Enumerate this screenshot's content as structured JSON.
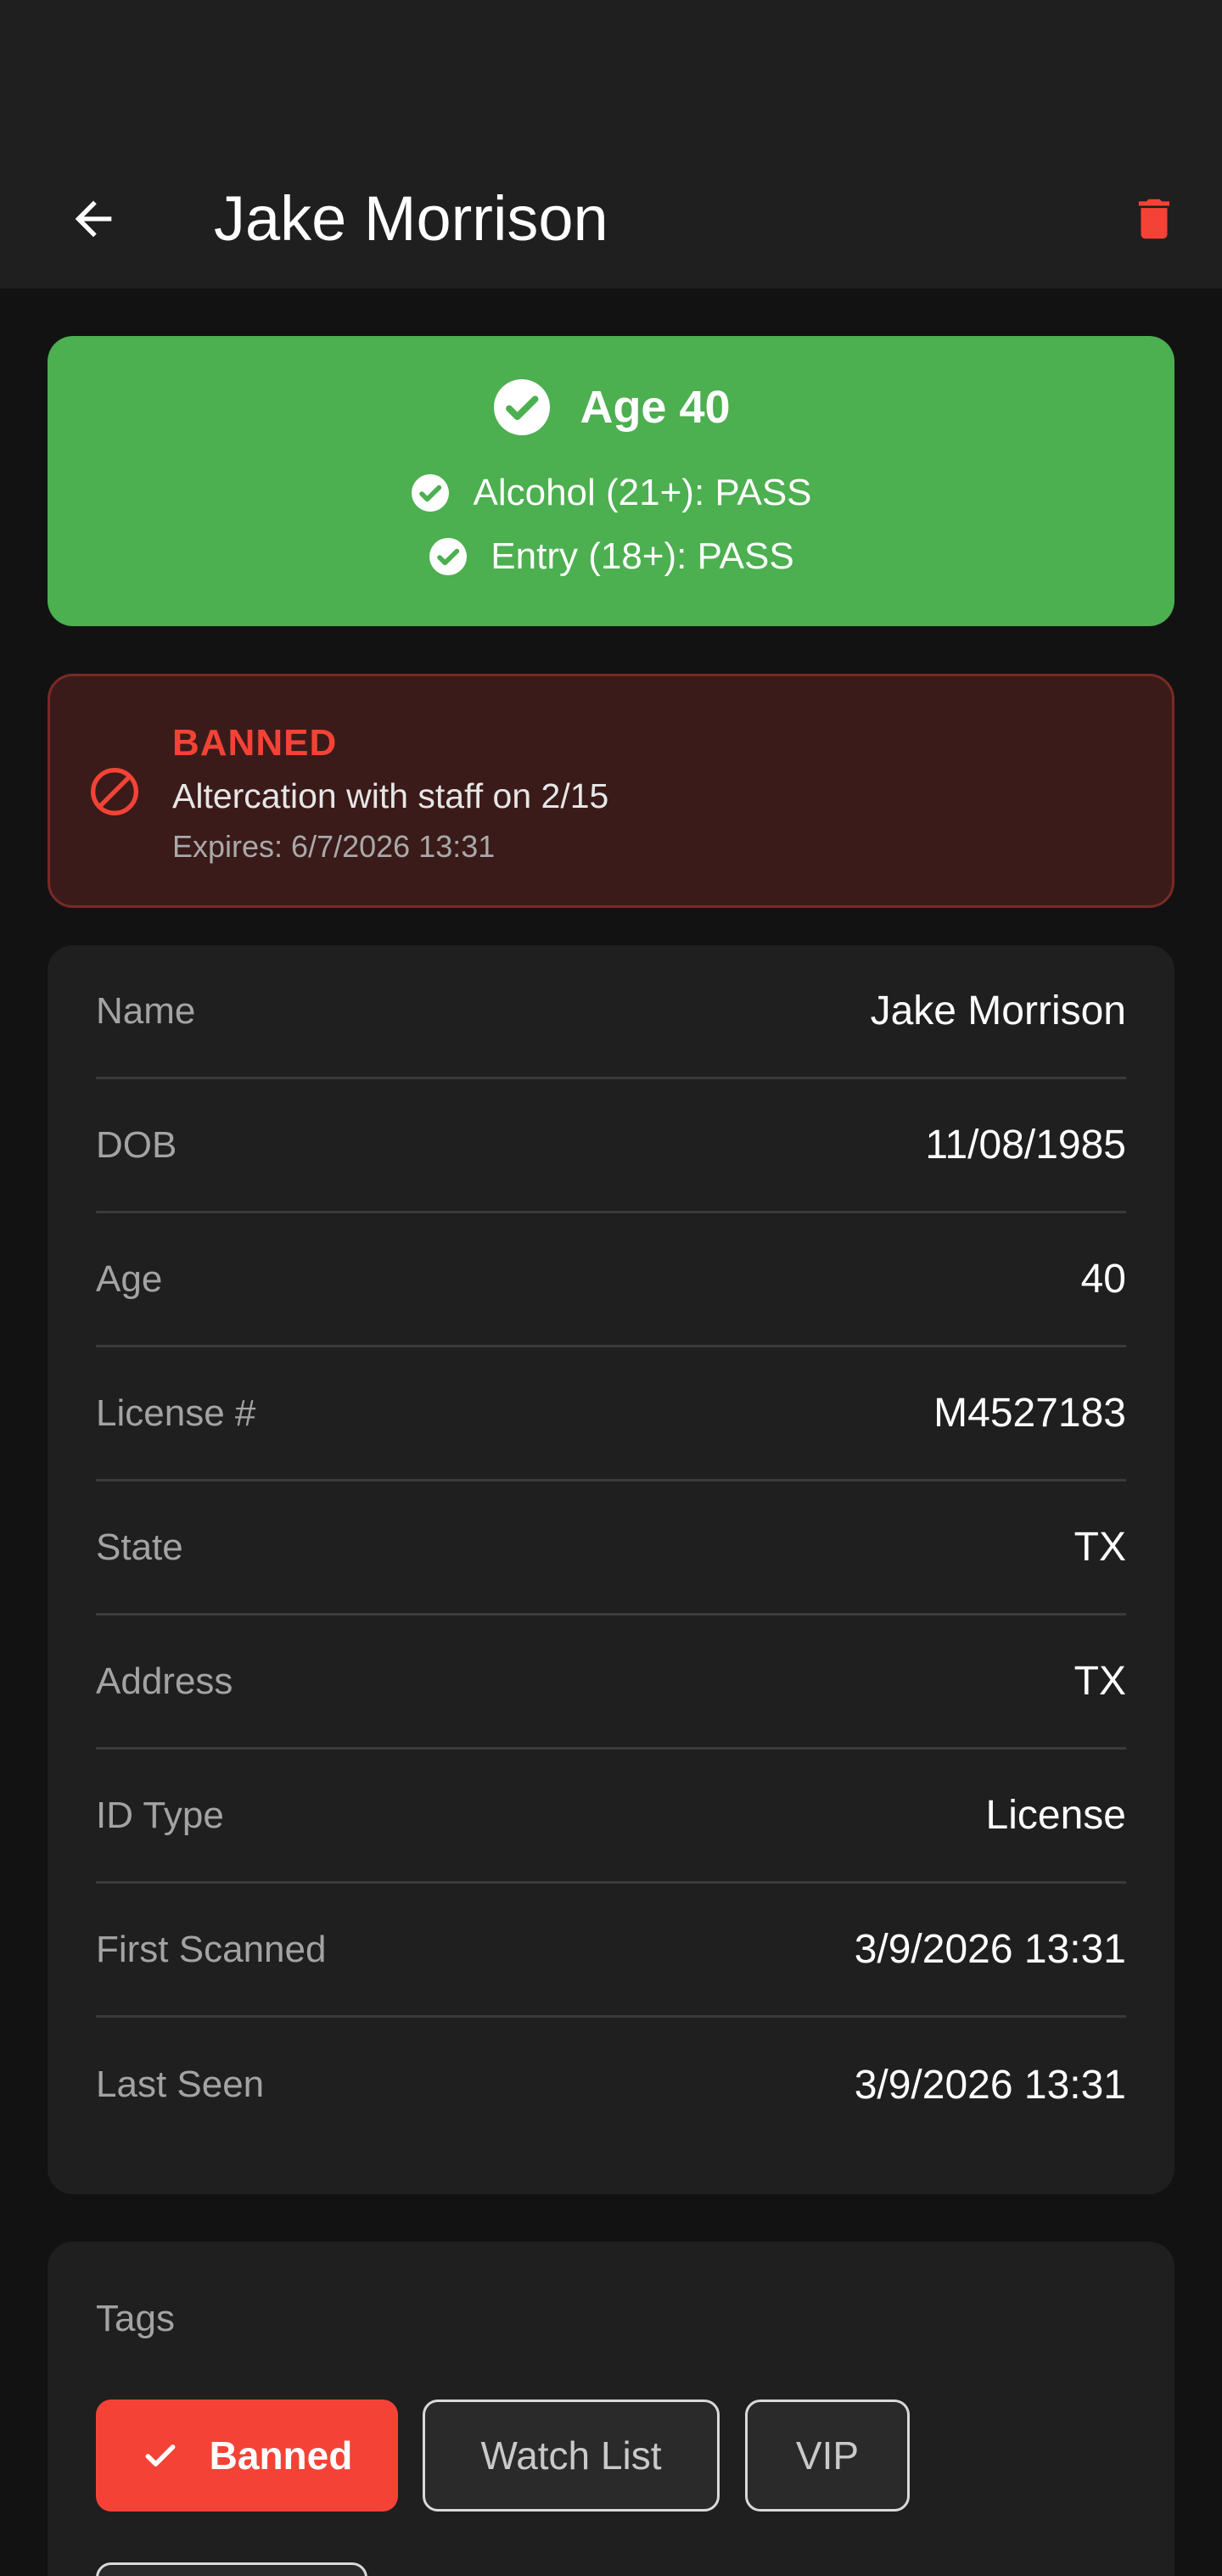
{
  "header": {
    "title": "Jake Morrison"
  },
  "icons": {
    "back": "back-arrow-icon",
    "delete": "trash-icon"
  },
  "colors": {
    "pass": "#4caf50",
    "danger": "#f44336",
    "surface": "#1f1f1f",
    "background": "#121212"
  },
  "age_check": {
    "headline": "Age 40",
    "checks": [
      "Alcohol (21+): PASS",
      "Entry (18+): PASS"
    ]
  },
  "ban": {
    "title": "BANNED",
    "reason": "Altercation with staff on 2/15",
    "expires": "Expires: 6/7/2026 13:31"
  },
  "details": [
    {
      "label": "Name",
      "value": "Jake Morrison"
    },
    {
      "label": "DOB",
      "value": "11/08/1985"
    },
    {
      "label": "Age",
      "value": "40"
    },
    {
      "label": "License #",
      "value": "M4527183"
    },
    {
      "label": "State",
      "value": "TX"
    },
    {
      "label": "Address",
      "value": "TX"
    },
    {
      "label": "ID Type",
      "value": "License"
    },
    {
      "label": "First Scanned",
      "value": "3/9/2026 13:31"
    },
    {
      "label": "Last Seen",
      "value": "3/9/2026 13:31"
    }
  ],
  "tags": {
    "label": "Tags",
    "chips": [
      {
        "label": "Banned",
        "selected": true
      },
      {
        "label": "Watch List",
        "selected": false
      },
      {
        "label": "VIP",
        "selected": false
      }
    ]
  }
}
